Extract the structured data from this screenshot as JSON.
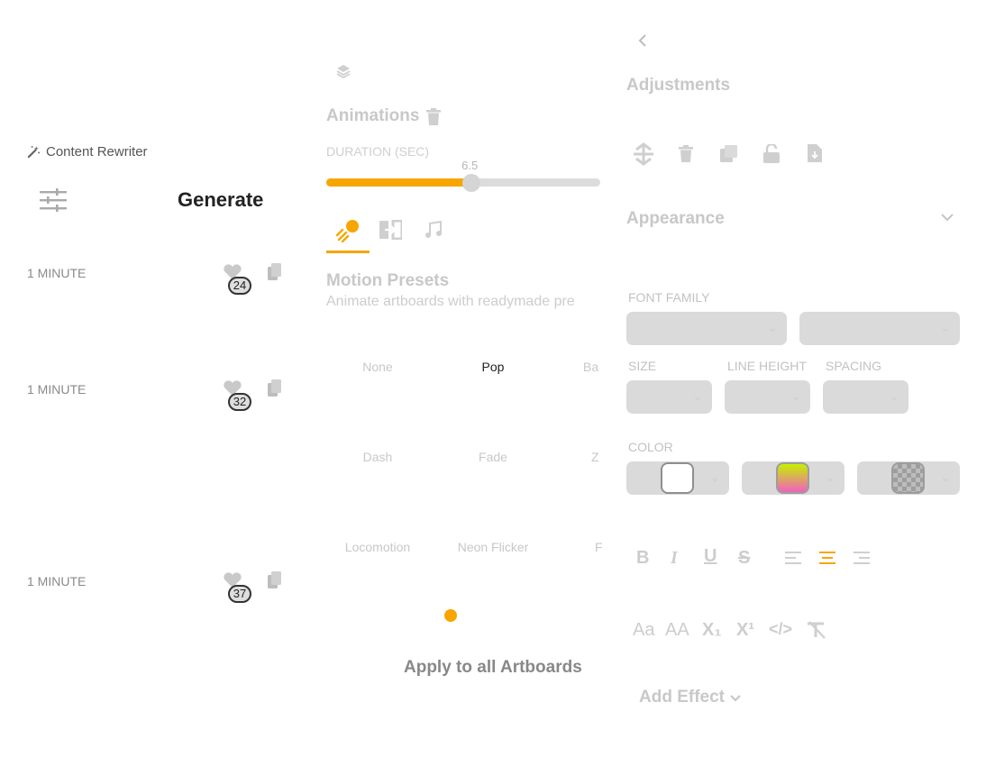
{
  "left_panel": {
    "tool_title": "Content Rewriter",
    "generate_label": "Generate",
    "results": [
      {
        "time": "1 MINUTE",
        "likes": "24"
      },
      {
        "time": "1 MINUTE",
        "likes": "32"
      },
      {
        "time": "1 MINUTE",
        "likes": "37"
      }
    ]
  },
  "animations": {
    "title": "Animations",
    "duration_label": "DURATION (SEC)",
    "duration_value": "6.5",
    "duration_fraction": 0.53,
    "presets_title": "Motion Presets",
    "presets_subtitle": "Animate artboards with readymade pre",
    "presets": [
      [
        "None",
        "Pop",
        "Ba"
      ],
      [
        "Dash",
        "Fade",
        "Z"
      ],
      [
        "Locomotion",
        "Neon Flicker",
        "F"
      ]
    ],
    "selected_preset": "Pop",
    "apply_label": "Apply to all Artboards"
  },
  "adjustments": {
    "title": "Adjustments",
    "appearance_label": "Appearance",
    "font_family_label": "FONT FAMILY",
    "size_label": "SIZE",
    "line_height_label": "LINE HEIGHT",
    "spacing_label": "SPACING",
    "color_label": "COLOR",
    "case_buttons": [
      "Aa",
      "AA",
      "X₁",
      "X¹",
      "</>"
    ],
    "add_effect_label": "Add Effect"
  },
  "colors": {
    "accent": "#F7A600",
    "swatch_white": "#FFFFFF",
    "swatch_gradient_top": "#C7F000",
    "swatch_gradient_bottom": "#F060C0"
  }
}
